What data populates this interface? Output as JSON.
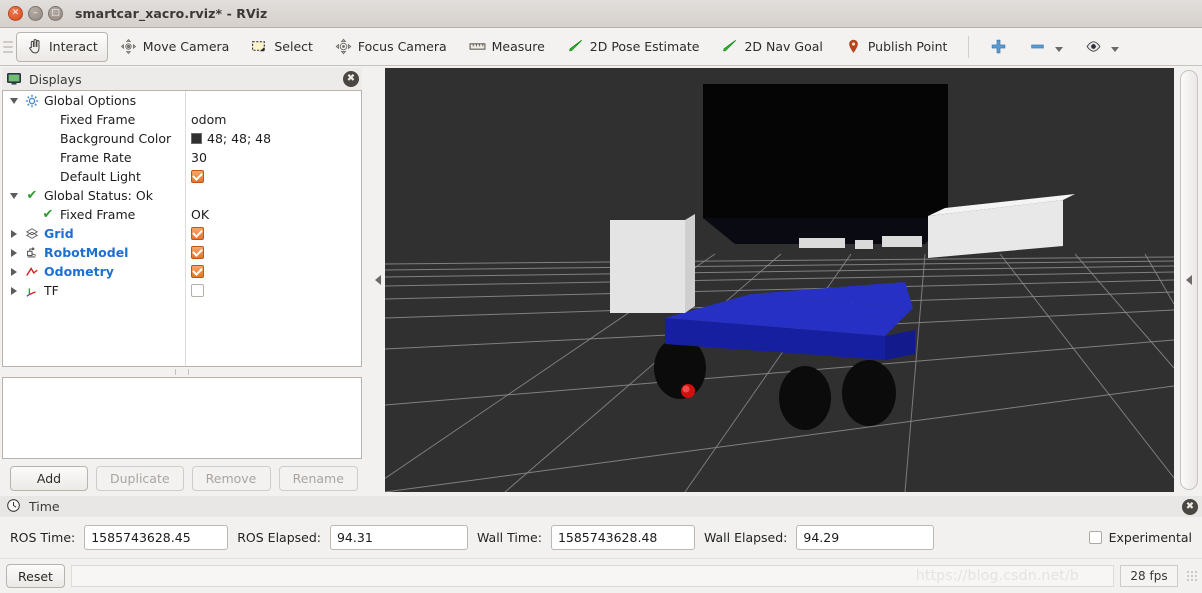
{
  "window": {
    "title": "smartcar_xacro.rviz* - RViz",
    "buttons": {
      "close": "×",
      "minimize": "–",
      "maximize": "□"
    }
  },
  "toolbar": {
    "items": [
      {
        "label": "Interact",
        "icon": "hand-cursor-icon",
        "active": true
      },
      {
        "label": "Move Camera",
        "icon": "move-camera-icon",
        "active": false
      },
      {
        "label": "Select",
        "icon": "select-rectangle-icon",
        "active": false
      },
      {
        "label": "Focus Camera",
        "icon": "focus-camera-icon",
        "active": false
      },
      {
        "label": "Measure",
        "icon": "ruler-icon",
        "active": false
      },
      {
        "label": "2D Pose Estimate",
        "icon": "pose-arrow-icon",
        "active": false
      },
      {
        "label": "2D Nav Goal",
        "icon": "nav-goal-arrow-icon",
        "active": false
      },
      {
        "label": "Publish Point",
        "icon": "map-pin-icon",
        "active": false
      }
    ],
    "tools": [
      {
        "icon": "plus-icon",
        "dropdown": false
      },
      {
        "icon": "minus-icon",
        "dropdown": true
      },
      {
        "icon": "eye-icon",
        "dropdown": true
      }
    ]
  },
  "displays": {
    "title": "Displays",
    "icon": "monitor-icon",
    "close": "✖",
    "tree": [
      {
        "name": "Global Options",
        "twisty": "down",
        "icon": "gear-icon",
        "value": "",
        "value_type": "none",
        "link": false,
        "indent": 0
      },
      {
        "name": "Fixed Frame",
        "twisty": "none",
        "icon": "none",
        "value": "odom",
        "value_type": "text",
        "link": false,
        "indent": 1
      },
      {
        "name": "Background Color",
        "twisty": "none",
        "icon": "none",
        "value": "48; 48; 48",
        "value_type": "color",
        "color": "#303030",
        "link": false,
        "indent": 1
      },
      {
        "name": "Frame Rate",
        "twisty": "none",
        "icon": "none",
        "value": "30",
        "value_type": "text",
        "link": false,
        "indent": 1
      },
      {
        "name": "Default Light",
        "twisty": "none",
        "icon": "none",
        "value": "",
        "value_type": "checkbox-on",
        "link": false,
        "indent": 1
      },
      {
        "name": "Global Status: Ok",
        "twisty": "down",
        "icon": "green-check-icon",
        "value": "",
        "value_type": "none",
        "link": false,
        "indent": 0
      },
      {
        "name": "Fixed Frame",
        "twisty": "none",
        "icon": "green-check-icon",
        "value": "OK",
        "value_type": "text",
        "link": false,
        "indent": 1
      },
      {
        "name": "Grid",
        "twisty": "right",
        "icon": "grid-icon",
        "value": "",
        "value_type": "checkbox-on",
        "link": true,
        "indent": 0
      },
      {
        "name": "RobotModel",
        "twisty": "right",
        "icon": "robot-icon",
        "value": "",
        "value_type": "checkbox-on",
        "link": true,
        "indent": 0
      },
      {
        "name": "Odometry",
        "twisty": "right",
        "icon": "odometry-icon",
        "value": "",
        "value_type": "checkbox-on",
        "link": true,
        "indent": 0
      },
      {
        "name": "TF",
        "twisty": "right",
        "icon": "tf-axes-icon",
        "value": "",
        "value_type": "checkbox-off",
        "link": false,
        "indent": 0
      }
    ],
    "buttons": [
      {
        "label": "Add",
        "disabled": false
      },
      {
        "label": "Duplicate",
        "disabled": true
      },
      {
        "label": "Remove",
        "disabled": true
      },
      {
        "label": "Rename",
        "disabled": true
      }
    ]
  },
  "viewport": {
    "background_color": "#303030",
    "grid_color": "#9a9a9a",
    "robot": {
      "chassis_color": "#1a23a8",
      "chassis_top_color": "#2b35c8",
      "wheel_color": "#0a0a0a",
      "box_color": "#070707",
      "sensor_color": "#e2e2e2",
      "odom_marker_color": "#d81010"
    }
  },
  "time": {
    "title": "Time",
    "icon": "clock-icon",
    "close": "✖",
    "fields": [
      {
        "label": "ROS Time:",
        "value": "1585743628.45",
        "width": "long"
      },
      {
        "label": "ROS Elapsed:",
        "value": "94.31",
        "width": "mid"
      },
      {
        "label": "Wall Time:",
        "value": "1585743628.48",
        "width": "long"
      },
      {
        "label": "Wall Elapsed:",
        "value": "94.29",
        "width": "mid"
      }
    ],
    "experimental": {
      "label": "Experimental",
      "checked": false
    }
  },
  "statusbar": {
    "reset_label": "Reset",
    "status_text": "",
    "watermark": "https://blog.csdn.net/b",
    "fps": "28 fps"
  }
}
